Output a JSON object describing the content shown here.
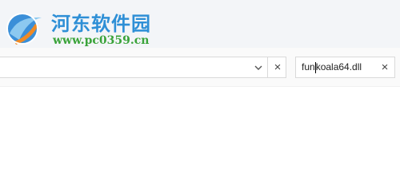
{
  "watermark": {
    "logo_icon": "hedong-logo-icon",
    "name": "河东软件园",
    "url": "www.pc0359.cn",
    "name_color": "#2e8fd6",
    "url_color": "#3aa33a"
  },
  "address_bar": {
    "value": "",
    "dropdown_icon": "chevron-down-icon",
    "clear_label": "×"
  },
  "search": {
    "value_before_caret": "fun",
    "value_after_caret": "koala64.dll",
    "clear_label": "×"
  }
}
